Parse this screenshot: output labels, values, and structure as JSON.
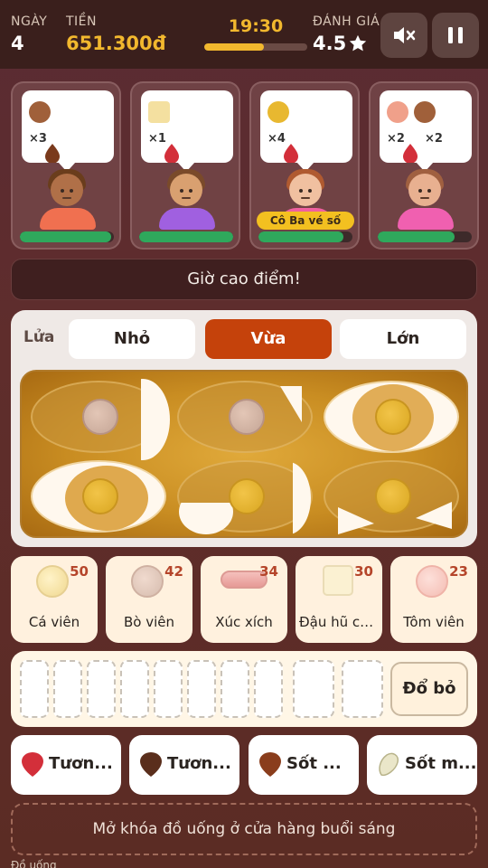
{
  "header": {
    "day_label": "NGÀY",
    "day_value": "4",
    "money_label": "TIỀN",
    "money_value": "651.300đ",
    "timer": "19:30",
    "timer_progress": 0.58,
    "rating_label": "ĐÁNH GIÁ",
    "rating_value": "4.5",
    "mute_icon": "speaker-muted-icon",
    "pause_icon": "pause-icon"
  },
  "customers": [
    {
      "qtys": [
        "×3"
      ],
      "name": "",
      "patience": 0.97
    },
    {
      "qtys": [
        "×1"
      ],
      "name": "",
      "patience": 1.0
    },
    {
      "qtys": [
        "×4"
      ],
      "name": "Cô Ba vé số",
      "patience": 0.9
    },
    {
      "qtys": [
        "×2",
        "×2"
      ],
      "name": "",
      "patience": 0.82
    }
  ],
  "event": "Giờ cao điểm!",
  "fire": {
    "label": "Lửa",
    "options": [
      "Nhỏ",
      "Vừa",
      "Lớn"
    ],
    "selected": "Vừa"
  },
  "ingredients": [
    {
      "label": "Cá viên",
      "count": "50"
    },
    {
      "label": "Bò viên",
      "count": "42"
    },
    {
      "label": "Xúc xích",
      "count": "34"
    },
    {
      "label": "Đậu hũ chi...",
      "count": "30"
    },
    {
      "label": "Tôm viên",
      "count": "23"
    }
  ],
  "tray": {
    "discard_label": "Đổ bỏ"
  },
  "sauces": [
    {
      "label": "Tươn...",
      "icon": "chili-sauce-icon",
      "color": "#d32f3a"
    },
    {
      "label": "Tươn...",
      "icon": "soy-sauce-icon",
      "color": "#5a2e1c"
    },
    {
      "label": "Sốt ...",
      "icon": "satay-sauce-icon",
      "color": "#8a3d1c"
    },
    {
      "label": "Sốt m...",
      "icon": "mayo-sauce-icon",
      "color": "#eae6c9"
    }
  ],
  "unlock_hint": "Mở khóa đồ uống ở cửa hàng buổi sáng",
  "footer": "Đồ uống"
}
